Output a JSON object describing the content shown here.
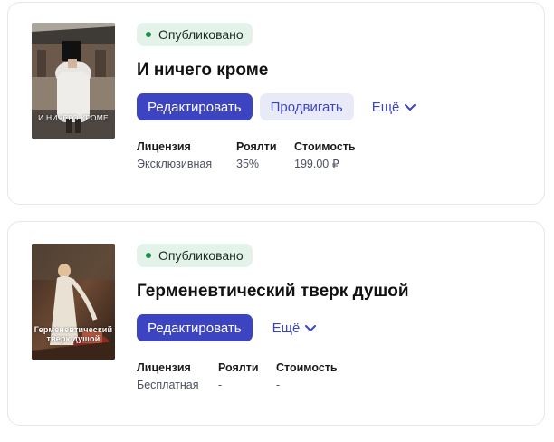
{
  "colors": {
    "accent": "#3c44c2",
    "accent_soft": "#e9eaf8",
    "status_bg": "#e3f3e9",
    "status_dot": "#1e8e4e",
    "border": "#e4e6f0"
  },
  "books": [
    {
      "status": "Опубликовано",
      "title": "И ничего кроме",
      "cover_title": "И НИЧЕГО КРОМЕ",
      "buttons": {
        "edit": "Редактировать",
        "promote": "Продвигать",
        "more": "Ещё"
      },
      "meta": {
        "license_label": "Лицензия",
        "license_value": "Эксклюзивная",
        "royalty_label": "Роялти",
        "royalty_value": "35%",
        "price_label": "Стоимость",
        "price_value": "199.00 ₽"
      },
      "icons": {
        "more": "chevron-down-icon"
      }
    },
    {
      "status": "Опубликовано",
      "title": "Герменевтический тверк душой",
      "cover_title": "Герменевтический тверк душой",
      "buttons": {
        "edit": "Редактировать",
        "more": "Ещё"
      },
      "meta": {
        "license_label": "Лицензия",
        "license_value": "Бесплатная",
        "royalty_label": "Роялти",
        "royalty_value": "-",
        "price_label": "Стоимость",
        "price_value": "-"
      },
      "icons": {
        "more": "chevron-down-icon"
      }
    }
  ]
}
